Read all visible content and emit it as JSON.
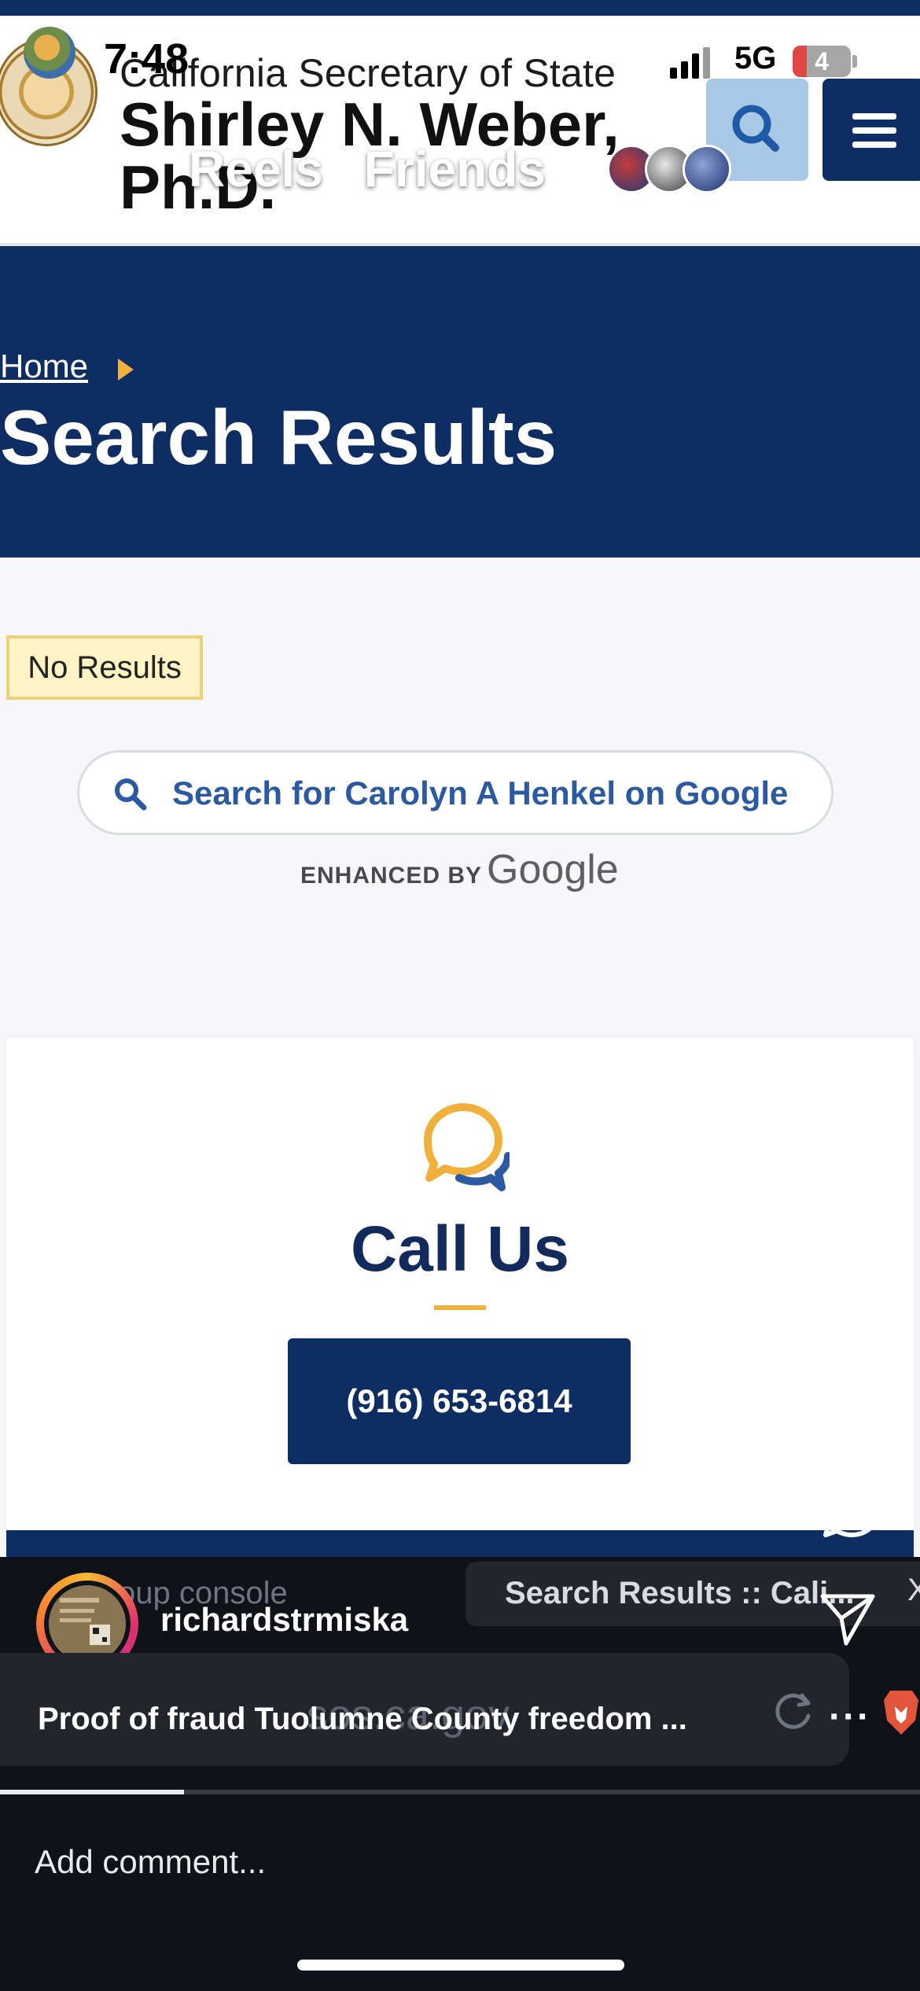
{
  "status_bar": {
    "time": "7:48",
    "network": "5G",
    "battery": "4",
    "battery_level_percent": 4
  },
  "site_header": {
    "office": "California Secretary of State",
    "name": "Shirley N. Weber, Ph.D.",
    "seal_icon": "california-state-seal-icon",
    "search_icon": "search-icon",
    "menu_icon": "hamburger-menu-icon"
  },
  "instagram_overlay_top": {
    "tabs": [
      "Reels",
      "Friends"
    ],
    "friend_avatar_count": 3
  },
  "banner": {
    "breadcrumb_home": "Home",
    "page_title": "Search Results"
  },
  "results": {
    "no_results_label": "No Results",
    "google_search_label": "Search for Carolyn A Henkel on Google",
    "enhanced_by": "ENHANCED BY",
    "google_wordmark": "Google"
  },
  "call_card": {
    "title": "Call Us",
    "phone": "(916) 653-6814",
    "icon": "chat-bubbles-icon"
  },
  "instagram_post": {
    "username": "richardstrmiska",
    "caption": "Proof of fraud Tuolumne County freedom ...",
    "comment_placeholder": "Add comment...",
    "ghost_console_text": "oup console",
    "browser_tab_title": "Search Results :: Cali...",
    "browser_tab_close": "X",
    "ghost_url": "sos.ca.gov",
    "video_progress_fraction": 0.2,
    "icons": [
      "heart-icon",
      "comment-icon",
      "send-icon",
      "reload-icon",
      "more-icon",
      "brave-lion-icon"
    ]
  },
  "colors": {
    "navy": "#0e2d62",
    "gold": "#f0b13c",
    "link_blue": "#2c5aa0",
    "no_results_bg": "#fdf3c4"
  }
}
